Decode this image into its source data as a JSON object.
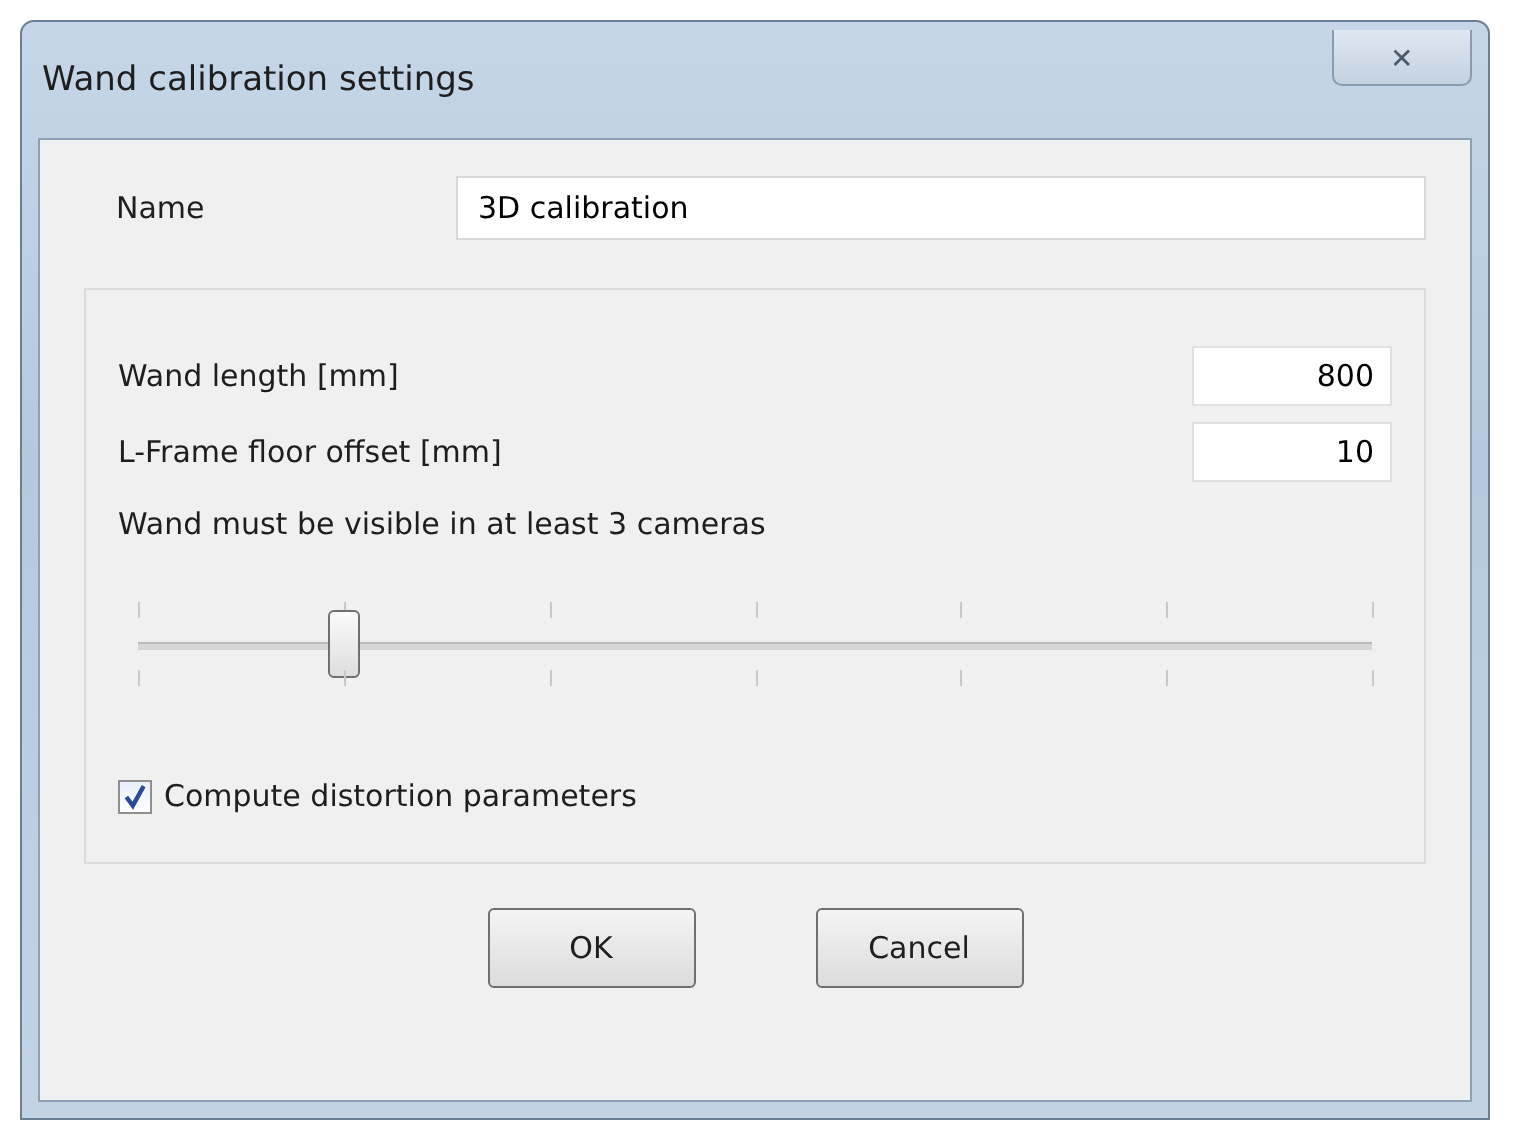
{
  "window": {
    "title": "Wand calibration settings",
    "close": "✕"
  },
  "name_field": {
    "label": "Name",
    "value": "3D calibration"
  },
  "fields": [
    {
      "label": "Wand length [mm]",
      "value": "800"
    },
    {
      "label": "L-Frame floor offset [mm]",
      "value": "10"
    }
  ],
  "slider": {
    "label": "Wand must be visible in at least 3 cameras",
    "level": 0.167
  },
  "checkbox": {
    "label": "Compute distortion parameters",
    "checked": true
  },
  "buttons": [
    "OK",
    "Cancel"
  ]
}
